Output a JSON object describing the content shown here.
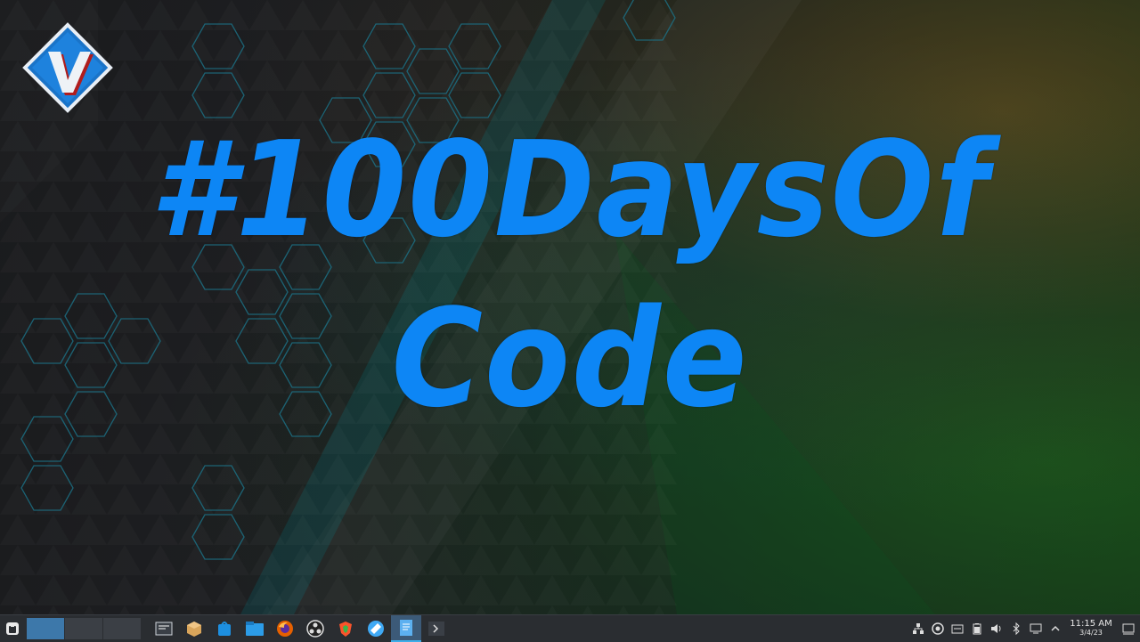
{
  "desktop": {
    "headline_line1": "#100DaysOf",
    "headline_line2": "Code",
    "logo_letter": "V",
    "accent_color": "#0d86f5"
  },
  "taskbar": {
    "launcher_icon": "application-launcher-icon",
    "virtual_desktops": 3,
    "active_desktop": 1,
    "apps": [
      {
        "name": "system-monitor-icon"
      },
      {
        "name": "package-manager-icon"
      },
      {
        "name": "software-store-icon"
      },
      {
        "name": "file-manager-icon"
      },
      {
        "name": "firefox-icon"
      },
      {
        "name": "obs-studio-icon"
      },
      {
        "name": "brave-browser-icon"
      },
      {
        "name": "krita-icon"
      },
      {
        "name": "text-editor-icon",
        "active": true
      },
      {
        "name": "terminal-icon"
      }
    ],
    "tray_icons": [
      "network-icon",
      "vpn-icon",
      "clipboard-icon",
      "battery-icon",
      "volume-icon",
      "bluetooth-icon",
      "display-icon",
      "expand-tray-icon"
    ],
    "clock_time": "11:15 AM",
    "clock_date": "3/4/23"
  }
}
